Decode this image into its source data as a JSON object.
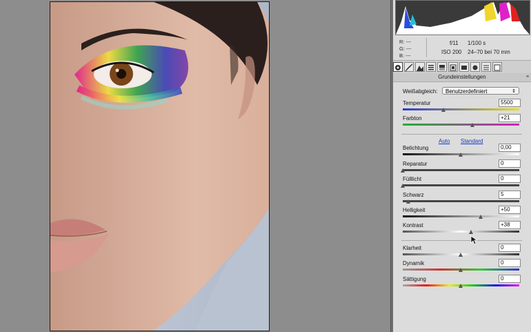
{
  "readout": {
    "r": "R:  ---",
    "g": "G:  ---",
    "b": "B:  ---",
    "aperture": "f/11",
    "shutter": "1/100 s",
    "iso": "ISO 200",
    "lens": "24–70 bei 70 mm"
  },
  "panel": {
    "section_title": "Grundeinstellungen",
    "white_balance_label": "Weißabgleich:",
    "white_balance_value": "Benutzerdefiniert",
    "auto_link": "Auto",
    "standard_link": "Standard"
  },
  "sliders": [
    {
      "label": "Temperatur",
      "value": "5500",
      "level": 0.35
    },
    {
      "label": "Farbton",
      "value": "+21",
      "level": 0.6
    },
    {
      "label": "Belichtung",
      "value": "0,00",
      "level": 0.5
    },
    {
      "label": "Reparatur",
      "value": "0",
      "level": 0.0
    },
    {
      "label": "Fülllicht",
      "value": "0",
      "level": 0.0
    },
    {
      "label": "Schwarz",
      "value": "5",
      "level": 0.05
    },
    {
      "label": "Helligkeit",
      "value": "+50",
      "level": 0.67
    },
    {
      "label": "Kontrast",
      "value": "+38",
      "level": 0.59
    },
    {
      "label": "Klarheit",
      "value": "0",
      "level": 0.5
    },
    {
      "label": "Dynamik",
      "value": "0",
      "level": 0.5
    },
    {
      "label": "Sättigung",
      "value": "0",
      "level": 0.5
    }
  ],
  "colors": {
    "panel_bg": "#dcdcdc",
    "canvas_bg": "#8d8d8d",
    "link": "#1c3bbd"
  },
  "icons": [
    "camera-icon",
    "curve-icon",
    "detail-icon",
    "hsl-icon",
    "split-toning-icon",
    "lens-icon",
    "effects-icon",
    "calibration-icon",
    "presets-icon",
    "snapshots-icon"
  ]
}
